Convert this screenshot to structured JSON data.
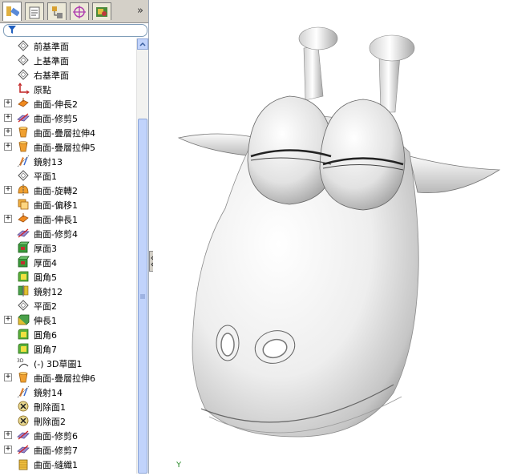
{
  "panel_tabs": [
    {
      "name": "feature-manager",
      "icon": "feature-tree-icon",
      "active": true
    },
    {
      "name": "property-manager",
      "icon": "property-icon",
      "active": false
    },
    {
      "name": "configuration-manager",
      "icon": "configuration-icon",
      "active": false
    },
    {
      "name": "dimxpert-manager",
      "icon": "crosshair-icon",
      "active": false
    },
    {
      "name": "display-manager",
      "icon": "display-icon",
      "active": false
    }
  ],
  "overflow_glyph": "»",
  "tree": [
    {
      "label": "前基準面",
      "icon": "plane",
      "expand": false
    },
    {
      "label": "上基準面",
      "icon": "plane",
      "expand": false
    },
    {
      "label": "右基準面",
      "icon": "plane",
      "expand": false
    },
    {
      "label": "原點",
      "icon": "origin",
      "expand": false
    },
    {
      "label": "曲面-伸長2",
      "icon": "surface-extrude",
      "expand": true
    },
    {
      "label": "曲面-修剪5",
      "icon": "surface-trim",
      "expand": true
    },
    {
      "label": "曲面-疊層拉伸4",
      "icon": "surface-loft",
      "expand": true
    },
    {
      "label": "曲面-疊層拉伸5",
      "icon": "surface-loft",
      "expand": true
    },
    {
      "label": "鏡射13",
      "icon": "mirror",
      "expand": false
    },
    {
      "label": "平面1",
      "icon": "plane",
      "expand": false
    },
    {
      "label": "曲面-旋轉2",
      "icon": "surface-revolve",
      "expand": true
    },
    {
      "label": "曲面-偏移1",
      "icon": "surface-offset",
      "expand": false
    },
    {
      "label": "曲面-伸長1",
      "icon": "surface-extrude",
      "expand": true
    },
    {
      "label": "曲面-修剪4",
      "icon": "surface-trim",
      "expand": false
    },
    {
      "label": "厚面3",
      "icon": "thicken",
      "expand": false
    },
    {
      "label": "厚面4",
      "icon": "thicken",
      "expand": false
    },
    {
      "label": "圓角5",
      "icon": "fillet",
      "expand": false
    },
    {
      "label": "鏡射12",
      "icon": "mirror-body",
      "expand": false
    },
    {
      "label": "平面2",
      "icon": "plane",
      "expand": false
    },
    {
      "label": "伸長1",
      "icon": "extrude",
      "expand": true
    },
    {
      "label": "圓角6",
      "icon": "fillet",
      "expand": false
    },
    {
      "label": "圓角7",
      "icon": "fillet",
      "expand": false
    },
    {
      "label": "(-) 3D草圖1",
      "icon": "sketch3d",
      "expand": false
    },
    {
      "label": "曲面-疊層拉伸6",
      "icon": "surface-loft",
      "expand": true
    },
    {
      "label": "鏡射14",
      "icon": "mirror",
      "expand": false
    },
    {
      "label": "刪除面1",
      "icon": "delete-face",
      "expand": false
    },
    {
      "label": "刪除面2",
      "icon": "delete-face",
      "expand": false
    },
    {
      "label": "曲面-修剪6",
      "icon": "surface-trim",
      "expand": true
    },
    {
      "label": "曲面-修剪7",
      "icon": "surface-trim",
      "expand": true
    },
    {
      "label": "曲面-縫織1",
      "icon": "surface-knit",
      "expand": false
    }
  ],
  "viewport": {
    "axis_label": "Y"
  },
  "colors": {
    "panel_bg": "#ffffff",
    "tab_bg": "#d4d0c8",
    "scroll_accent": "#c1d3fb",
    "model_shade": "#e6e6e6"
  }
}
